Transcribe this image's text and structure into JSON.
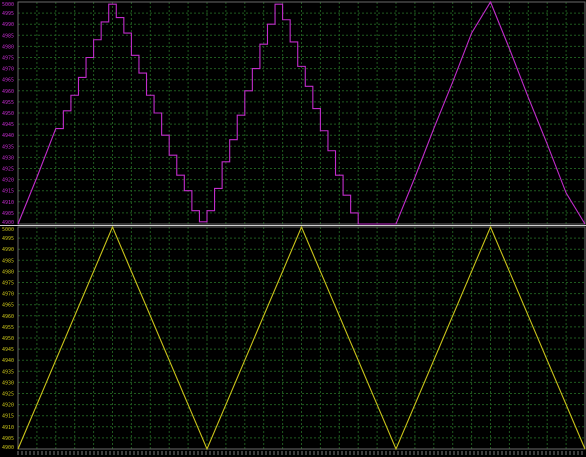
{
  "colors": {
    "background": "#000000",
    "grid": "#1f5a1f",
    "panel_border": "#6a6a6a",
    "panel_divider": "#cfcfcf",
    "top_trace": "#c12ccb",
    "bottom_trace": "#c9c31a",
    "top_tick_text": "#c12ccb",
    "bottom_tick_text": "#c9c31a"
  },
  "chart_data": [
    {
      "type": "line",
      "panel": "top",
      "style": "stepped",
      "ylim": [
        4900,
        5000
      ],
      "y_ticks": [
        4900,
        4905,
        4910,
        4915,
        4920,
        4925,
        4930,
        4935,
        4940,
        4945,
        4950,
        4955,
        4960,
        4965,
        4970,
        4975,
        4980,
        4985,
        4990,
        4995,
        5000
      ],
      "y_tick_labels": [
        "4900",
        "4905",
        "4910",
        "4915",
        "4920",
        "4925",
        "4930",
        "4935",
        "4940",
        "4945",
        "4950",
        "4955",
        "4960",
        "4965",
        "4970",
        "4975",
        "4980",
        "4985",
        "4990",
        "4995",
        "5000"
      ],
      "xlim": [
        0,
        300
      ],
      "grid": true,
      "series": [
        {
          "color": "#c12ccb",
          "x": [
            0,
            10,
            20,
            24,
            28,
            32,
            36,
            40,
            44,
            48,
            52,
            56,
            60,
            64,
            68,
            72,
            76,
            80,
            84,
            88,
            92,
            96,
            100,
            104,
            108,
            112,
            116,
            120,
            124,
            128,
            132,
            136,
            140,
            144,
            148,
            152,
            156,
            160,
            164,
            168,
            172,
            176,
            180,
            184,
            188,
            192,
            196,
            200,
            210,
            220,
            230,
            240,
            250,
            260,
            270,
            280,
            290,
            300
          ],
          "y": [
            4900,
            4921,
            4943,
            4951,
            4958,
            4966,
            4975,
            4983,
            4991,
            4999,
            4993,
            4986,
            4976,
            4968,
            4958,
            4950,
            4940,
            4931,
            4922,
            4915,
            4906,
            4901,
            4906,
            4916,
            4928,
            4938,
            4949,
            4960,
            4970,
            4981,
            4990,
            4999,
            4992,
            4982,
            4971,
            4962,
            4952,
            4942,
            4933,
            4922,
            4913,
            4905,
            4900,
            4900,
            4900,
            4900,
            4900,
            4900,
            4921,
            4943,
            4964,
            4986,
            5000,
            4979,
            4957,
            4936,
            4914,
            4900
          ]
        }
      ]
    },
    {
      "type": "line",
      "panel": "bottom",
      "ylim": [
        4900,
        5000
      ],
      "y_ticks": [
        4900,
        4905,
        4910,
        4915,
        4920,
        4925,
        4930,
        4935,
        4940,
        4945,
        4950,
        4955,
        4960,
        4965,
        4970,
        4975,
        4980,
        4985,
        4990,
        4995,
        5000
      ],
      "y_tick_labels": [
        "4900",
        "4905",
        "4910",
        "4915",
        "4920",
        "4925",
        "4930",
        "4935",
        "4940",
        "4945",
        "4950",
        "4955",
        "4960",
        "4965",
        "4970",
        "4975",
        "4980",
        "4985",
        "4990",
        "4995",
        "5000"
      ],
      "xlim": [
        0,
        300
      ],
      "grid": true,
      "series": [
        {
          "color": "#c9c31a",
          "x": [
            0,
            50,
            100,
            150,
            200,
            250,
            300
          ],
          "y": [
            4900,
            5000,
            4900,
            5000,
            4900,
            5000,
            4900
          ]
        }
      ]
    }
  ]
}
